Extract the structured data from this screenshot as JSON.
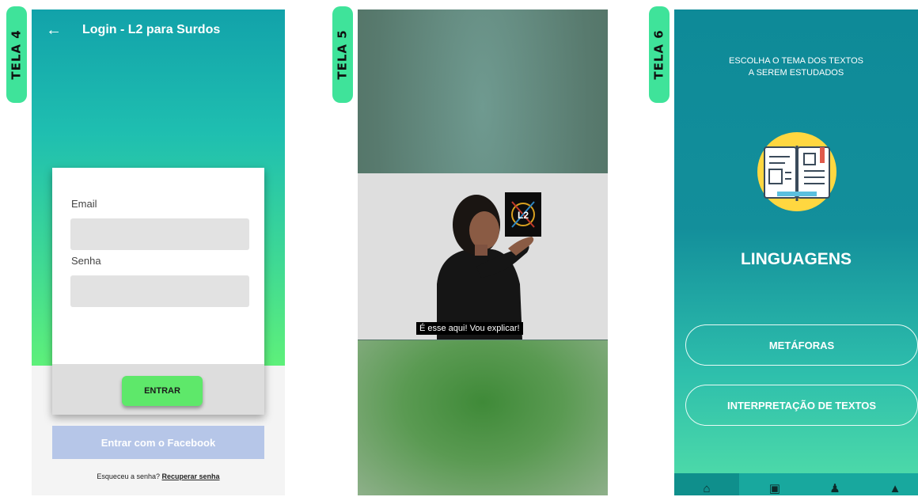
{
  "tags": [
    "TELA 4",
    "TELA 5",
    "TELA 6"
  ],
  "screen4": {
    "title": "Login - L2 para Surdos",
    "email_label": "Email",
    "password_label": "Senha",
    "submit_label": "ENTRAR",
    "facebook_label": "Entrar com o Facebook",
    "forgot_text": "Esqueceu a senha?",
    "recover_link": "Recuperar senha"
  },
  "screen5": {
    "subtitle": "É esse aqui! Vou explicar!",
    "logo_text": "L2"
  },
  "screen6": {
    "heading_line1": "ESCOLHA O TEMA DOS TEXTOS",
    "heading_line2": "A SEREM ESTUDADOS",
    "topic": "LINGUAGENS",
    "options": [
      "METÁFORAS",
      "INTERPRETAÇÃO DE TEXTOS"
    ],
    "nav_icons": [
      "home-icon",
      "book-icon",
      "person-icon",
      "thumb-icon"
    ]
  },
  "colors": {
    "tag_green": "#3fe39a",
    "primary_button": "#5ee86a",
    "facebook_button": "#b6c6e8",
    "teal": "#0e8a98"
  }
}
